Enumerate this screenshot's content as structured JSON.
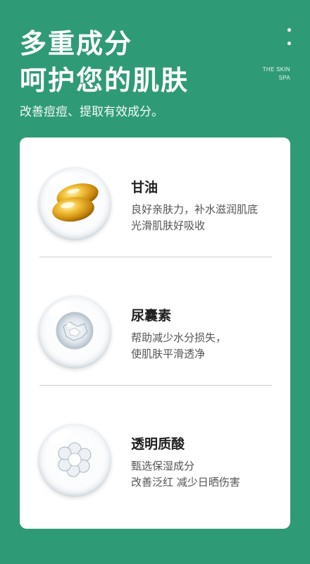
{
  "header": {
    "headline_line1": "多重成分",
    "headline_line2": "呵护您的肌肤",
    "brand_line1": "THE SKIN",
    "brand_line2": "SPA",
    "tagline": "改善痘痘、提取有效成分。"
  },
  "ingredients": [
    {
      "name": "甘油",
      "desc_line1": "良好亲肤力，补水滋润肌底",
      "desc_line2": "光滑肌肤好吸收",
      "icon": "golden-capsule-icon"
    },
    {
      "name": "尿囊素",
      "desc_line1": "帮助减少水分损失，",
      "desc_line2": "使肌肤平滑透净",
      "icon": "crystal-sphere-icon"
    },
    {
      "name": "透明质酸",
      "desc_line1": "甄选保湿成分",
      "desc_line2": "改善泛红 减少日晒伤害",
      "icon": "clear-flower-icon"
    }
  ],
  "colors": {
    "background": "#2f9a76",
    "card": "#ffffff",
    "capsule": "#e0a21a"
  }
}
